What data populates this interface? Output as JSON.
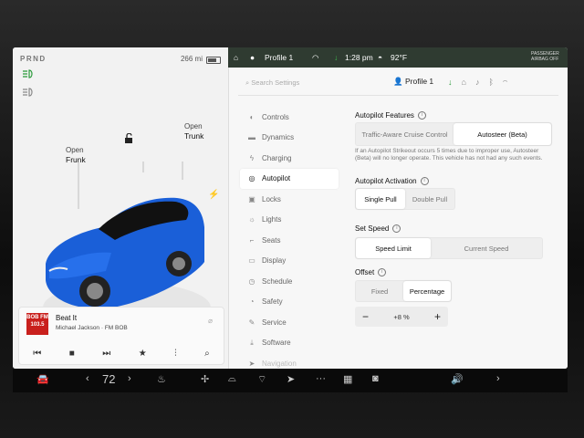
{
  "left": {
    "gear": "PRND",
    "range": "266 mi",
    "frunk": {
      "line1": "Open",
      "line2": "Frunk"
    },
    "trunk": {
      "line1": "Open",
      "line2": "Trunk"
    }
  },
  "media": {
    "station_logo": "BOB FM 103.5",
    "song": "Beat It",
    "artist": "Michael Jackson · FM BOB"
  },
  "topbar": {
    "profile": "Profile 1",
    "time": "1:28 pm",
    "temp": "92°F",
    "airbag": "PASSENGER AIRBAG OFF"
  },
  "settings": {
    "search_placeholder": "Search Settings",
    "profile": "Profile 1",
    "menu": [
      {
        "label": "Controls",
        "icon": "toggle-icon"
      },
      {
        "label": "Dynamics",
        "icon": "car-icon"
      },
      {
        "label": "Charging",
        "icon": "bolt-icon"
      },
      {
        "label": "Autopilot",
        "icon": "steering-wheel-icon",
        "selected": true
      },
      {
        "label": "Locks",
        "icon": "lock-icon"
      },
      {
        "label": "Lights",
        "icon": "sun-icon"
      },
      {
        "label": "Seats",
        "icon": "seat-icon"
      },
      {
        "label": "Display",
        "icon": "display-icon"
      },
      {
        "label": "Schedule",
        "icon": "clock-icon"
      },
      {
        "label": "Safety",
        "icon": "shield-icon"
      },
      {
        "label": "Service",
        "icon": "wrench-icon"
      },
      {
        "label": "Software",
        "icon": "download-icon"
      },
      {
        "label": "Navigation",
        "icon": "navigation-icon"
      }
    ],
    "autopilot_features": {
      "title": "Autopilot Features",
      "options": [
        "Traffic-Aware Cruise Control",
        "Autosteer (Beta)"
      ],
      "selected": 1,
      "note": "If an Autopilot Strikeout occurs 5 times due to improper use, Autosteer (Beta) will no longer operate. This vehicle has not had any such events."
    },
    "autopilot_activation": {
      "title": "Autopilot Activation",
      "options": [
        "Single Pull",
        "Double Pull"
      ],
      "selected": 0
    },
    "set_speed": {
      "title": "Set Speed",
      "options": [
        "Speed Limit",
        "Current Speed"
      ],
      "selected": 0
    },
    "offset": {
      "title": "Offset",
      "options": [
        "Fixed",
        "Percentage"
      ],
      "selected": 1,
      "value": "+8 %"
    }
  },
  "dock": {
    "temperature": "72"
  },
  "colors": {
    "accent_green": "#2a9a3a",
    "car_blue": "#1a5fd8"
  }
}
